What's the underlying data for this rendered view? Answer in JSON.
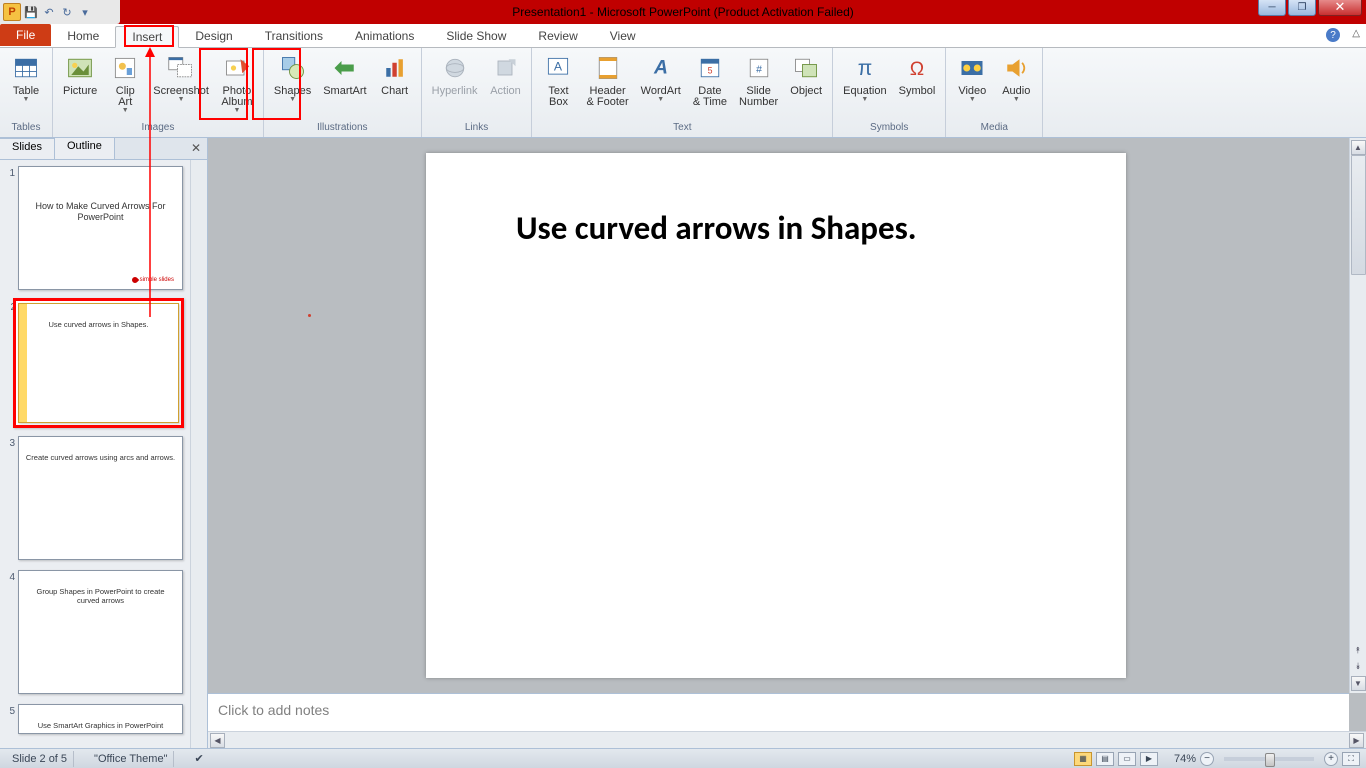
{
  "title": "Presentation1 - Microsoft PowerPoint (Product Activation Failed)",
  "tabs": {
    "file": "File",
    "home": "Home",
    "insert": "Insert",
    "design": "Design",
    "transitions": "Transitions",
    "animations": "Animations",
    "slideshow": "Slide Show",
    "review": "Review",
    "view": "View"
  },
  "ribbon": {
    "tables": {
      "label": "Tables",
      "table": "Table"
    },
    "images": {
      "label": "Images",
      "picture": "Picture",
      "clipart": "Clip\nArt",
      "screenshot": "Screenshot",
      "photoalbum": "Photo\nAlbum"
    },
    "illustrations": {
      "label": "Illustrations",
      "shapes": "Shapes",
      "smartart": "SmartArt",
      "chart": "Chart"
    },
    "links": {
      "label": "Links",
      "hyperlink": "Hyperlink",
      "action": "Action"
    },
    "text": {
      "label": "Text",
      "textbox": "Text\nBox",
      "headerfooter": "Header\n& Footer",
      "wordart": "WordArt",
      "datetime": "Date\n& Time",
      "slidenumber": "Slide\nNumber",
      "object": "Object"
    },
    "symbols": {
      "label": "Symbols",
      "equation": "Equation",
      "symbol": "Symbol"
    },
    "media": {
      "label": "Media",
      "video": "Video",
      "audio": "Audio"
    }
  },
  "side": {
    "slides": "Slides",
    "outline": "Outline"
  },
  "thumbs": [
    {
      "n": "1",
      "title": "How to Make Curved Arrows For PowerPoint",
      "brand": "simple slides"
    },
    {
      "n": "2",
      "title": "Use curved arrows in Shapes."
    },
    {
      "n": "3",
      "title": "Create curved arrows using arcs and arrows."
    },
    {
      "n": "4",
      "title": "Group Shapes in PowerPoint to create curved arrows"
    },
    {
      "n": "5",
      "title": "Use SmartArt Graphics in PowerPoint"
    }
  ],
  "slide_heading": "Use curved arrows in Shapes.",
  "notes_placeholder": "Click to add notes",
  "status": {
    "slide": "Slide 2 of 5",
    "theme": "\"Office Theme\"",
    "zoom": "74%"
  }
}
